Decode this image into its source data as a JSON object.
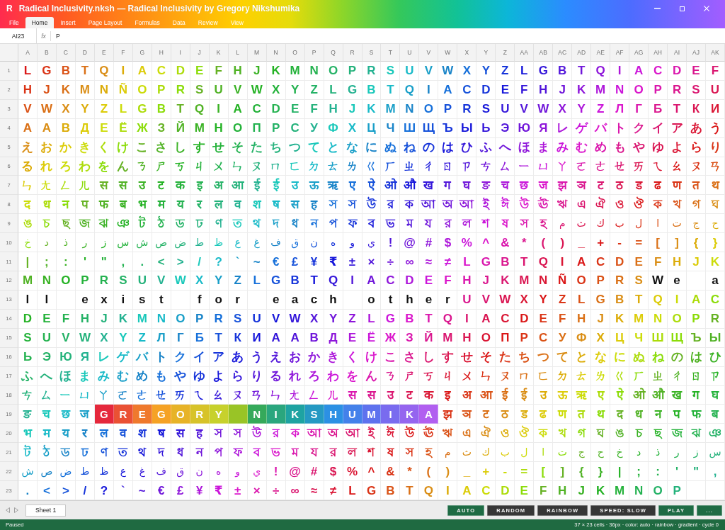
{
  "window": {
    "badge": "R",
    "title": "Radical Inclusivity.nksh — Radical Inclusivity by Gregory Nikshumika"
  },
  "menu": [
    {
      "label": "File",
      "selected": false
    },
    {
      "label": "Home",
      "selected": true
    },
    {
      "label": "Insert",
      "selected": false
    },
    {
      "label": "Page Layout",
      "selected": false
    },
    {
      "label": "Formulas",
      "selected": false
    },
    {
      "label": "Data",
      "selected": false
    },
    {
      "label": "Review",
      "selected": false
    },
    {
      "label": "View",
      "selected": false
    }
  ],
  "formula_bar": {
    "cell_ref": "AI23",
    "function_label": "fx",
    "value": "P"
  },
  "columns": [
    "A",
    "B",
    "C",
    "D",
    "E",
    "F",
    "G",
    "H",
    "I",
    "J",
    "K",
    "L",
    "M",
    "N",
    "O",
    "P",
    "Q",
    "R",
    "S",
    "T",
    "U",
    "V",
    "W",
    "X",
    "Y",
    "Z",
    "AA",
    "AB",
    "AC",
    "AD",
    "AE",
    "AF",
    "AG",
    "AH",
    "AI",
    "AJ",
    "AK"
  ],
  "rows": [
    {
      "number": "1",
      "segments": [
        {
          "kind": "glyphs",
          "chars": [
            "L",
            "G",
            "B",
            "T",
            "Q",
            "I",
            "A",
            "C",
            "D",
            "E",
            "F",
            "H",
            "J",
            "K",
            "M",
            "N",
            "O",
            "P",
            "R",
            "S",
            "U",
            "V",
            "W",
            "X",
            "Y",
            "Z",
            "L",
            "G",
            "B",
            "T",
            "Q",
            "I",
            "A",
            "C",
            "D",
            "E",
            "F"
          ]
        }
      ]
    },
    {
      "number": "2",
      "segments": [
        {
          "kind": "glyphs",
          "chars": [
            "H",
            "J",
            "K",
            "M",
            "N",
            "Ñ",
            "O",
            "P",
            "R",
            "S",
            "U",
            "V",
            "W",
            "X",
            "Y",
            "Z",
            "L",
            "G",
            "B",
            "T",
            "Q",
            "I",
            "A",
            "C",
            "D",
            "E",
            "F",
            "H",
            "J",
            "K",
            "M",
            "N",
            "O",
            "P",
            "R",
            "S",
            "U"
          ]
        }
      ]
    },
    {
      "number": "3",
      "segments": [
        {
          "kind": "glyphs",
          "chars": [
            "V",
            "W",
            "X",
            "Y",
            "Z",
            "L",
            "G",
            "B",
            "T",
            "Q",
            "I",
            "A",
            "C",
            "D",
            "E",
            "F",
            "H",
            "J",
            "K",
            "M",
            "N",
            "O",
            "P",
            "R",
            "S",
            "U",
            "V",
            "W",
            "X",
            "Y",
            "Z",
            "Л",
            "Г",
            "Б",
            "Т",
            "К",
            "И"
          ]
        }
      ]
    },
    {
      "number": "4",
      "segments": [
        {
          "kind": "glyphs",
          "chars": [
            "А",
            "А",
            "В",
            "Д",
            "Е",
            "Ё",
            "Ж",
            "З",
            "Й",
            "М",
            "Н",
            "О",
            "П",
            "Р",
            "С",
            "У",
            "Ф",
            "Х",
            "Ц",
            "Ч",
            "Ш",
            "Щ",
            "Ъ",
            "Ы",
            "Ь",
            "Э",
            "Ю",
            "Я",
            "レ",
            "ゲ",
            "バ",
            "ト",
            "ク",
            "イ",
            "ア",
            "あ",
            "う"
          ]
        }
      ]
    },
    {
      "number": "5",
      "segments": [
        {
          "kind": "glyphs",
          "chars": [
            "え",
            "お",
            "か",
            "き",
            "く",
            "け",
            "こ",
            "さ",
            "し",
            "す",
            "せ",
            "そ",
            "た",
            "ち",
            "つ",
            "て",
            "と",
            "な",
            "に",
            "ぬ",
            "ね",
            "の",
            "は",
            "ひ",
            "ふ",
            "へ",
            "ほ",
            "ま",
            "み",
            "む",
            "め",
            "も",
            "や",
            "ゆ",
            "よ",
            "ら",
            "り"
          ]
        }
      ]
    },
    {
      "number": "6",
      "segments": [
        {
          "kind": "glyphs",
          "chars": [
            "る",
            "れ",
            "ろ",
            "わ",
            "を",
            "ん",
            "ㄋ",
            "ㄕ",
            "ㄎ",
            "ㄐ",
            "ㄨ",
            "ㄣ",
            "ㄡ",
            "ㄇ",
            "ㄈ",
            "ㄉ",
            "ㄊ",
            "ㄌ",
            "ㄍ",
            "ㄏ",
            "ㄓ",
            "ㄔ",
            "ㄖ",
            "ㄗ",
            "ㄘ",
            "ㄙ",
            "ㄧ",
            "ㄩ",
            "ㄚ",
            "ㄛ",
            "ㄜ",
            "ㄝ",
            "ㄞ",
            "ㄟ",
            "ㄠ",
            "ㄡ",
            "ㄢ"
          ]
        }
      ]
    },
    {
      "number": "7",
      "segments": [
        {
          "kind": "glyphs",
          "chars": [
            "ㄣ",
            "ㄤ",
            "ㄥ",
            "ㄦ",
            "स",
            "स",
            "उ",
            "ट",
            "क",
            "इ",
            "अ",
            "आ",
            "ई",
            "ई",
            "उ",
            "ऊ",
            "ऋ",
            "ए",
            "ऐ",
            "ओ",
            "औ",
            "ख",
            "ग",
            "घ",
            "ङ",
            "च",
            "छ",
            "ज",
            "झ",
            "ञ",
            "ट",
            "ठ",
            "ड",
            "ढ",
            "ण",
            "त",
            "थ"
          ]
        }
      ]
    },
    {
      "number": "8",
      "segments": [
        {
          "kind": "glyphs",
          "chars": [
            "द",
            "ध",
            "न",
            "प",
            "फ",
            "ब",
            "भ",
            "म",
            "य",
            "र",
            "ल",
            "व",
            "श",
            "ष",
            "स",
            "ह",
            "স",
            "স",
            "উ",
            "র",
            "ক",
            "আ",
            "অ",
            "আ",
            "ই",
            "ঈ",
            "উ",
            "ঊ",
            "ঋ",
            "এ",
            "ঐ",
            "ও",
            "ঔ",
            "ক",
            "খ",
            "গ",
            "ঘ"
          ]
        }
      ]
    },
    {
      "number": "9",
      "segments": [
        {
          "kind": "glyphs",
          "chars": [
            "ঙ",
            "চ",
            "ছ",
            "জ",
            "ঝ",
            "ঞ",
            "ট",
            "ঠ",
            "ড",
            "ঢ",
            "ণ",
            "ত",
            "থ",
            "দ",
            "ধ",
            "ন",
            "প",
            "ফ",
            "ব",
            "ভ",
            "ম",
            "য",
            "র",
            "ল",
            "শ",
            "ষ",
            "স",
            "হ"
          ]
        },
        {
          "kind": "glyphs_rtl",
          "chars": [
            "ح",
            "ج",
            "ت",
            "ا",
            "ل",
            "ب",
            "ك",
            "ث",
            "م"
          ]
        }
      ]
    },
    {
      "number": "10",
      "segments": [
        {
          "kind": "glyphs_rtl",
          "chars": [
            "ي",
            "و",
            "ه",
            "ن",
            "ق",
            "ف",
            "غ",
            "ع",
            "ظ",
            "ط",
            "ض",
            "ص",
            "ش",
            "س",
            "ز",
            "ر",
            "ذ",
            "د",
            "خ"
          ]
        },
        {
          "kind": "glyphs",
          "chars": [
            "!",
            "@",
            "#",
            "$",
            "%",
            "^",
            "&",
            "*",
            "(",
            ")",
            "_",
            "+",
            "-",
            "=",
            "[",
            "]",
            "{",
            "}"
          ]
        }
      ]
    },
    {
      "number": "11",
      "segments": [
        {
          "kind": "glyphs",
          "chars": [
            "|",
            ";",
            ":",
            "'",
            "\"",
            ",",
            ".",
            "<",
            ">",
            "/",
            "?",
            "`",
            "~",
            "€",
            "£",
            "¥",
            "₹",
            "±",
            "×",
            "÷",
            "∞",
            "≈",
            "≠",
            "L",
            "G",
            "B",
            "T",
            "Q",
            "I",
            "A",
            "C",
            "D",
            "E",
            "F",
            "H",
            "J",
            "K"
          ]
        }
      ]
    },
    {
      "number": "12",
      "segments": [
        {
          "kind": "glyphs",
          "chars": [
            "M",
            "N",
            "O",
            "P",
            "R",
            "S",
            "U",
            "V",
            "W",
            "X",
            "Y",
            "Z",
            "L",
            "G",
            "B",
            "T",
            "Q",
            "I",
            "A",
            "C",
            "D",
            "E",
            "F",
            "H",
            "J",
            "K",
            "M",
            "N",
            "Ñ",
            "O",
            "P",
            "R",
            "S"
          ]
        },
        {
          "kind": "message",
          "chars": [
            "W",
            "e"
          ]
        },
        {
          "kind": "blank"
        },
        {
          "kind": "message",
          "chars": [
            "a"
          ]
        }
      ]
    },
    {
      "number": "13",
      "segments": [
        {
          "kind": "message",
          "chars": [
            "l",
            "l"
          ]
        },
        {
          "kind": "blank"
        },
        {
          "kind": "message",
          "chars": [
            "e",
            "x",
            "i",
            "s",
            "t"
          ]
        },
        {
          "kind": "blank"
        },
        {
          "kind": "message",
          "chars": [
            "f",
            "o",
            "r"
          ]
        },
        {
          "kind": "blank"
        },
        {
          "kind": "message",
          "chars": [
            "e",
            "a",
            "c",
            "h"
          ]
        },
        {
          "kind": "blank"
        },
        {
          "kind": "message",
          "chars": [
            "o",
            "t",
            "h",
            "e",
            "r"
          ]
        },
        {
          "kind": "glyphs",
          "chars": [
            "U",
            "V",
            "W",
            "X",
            "Y",
            "Z",
            "L",
            "G",
            "B",
            "T",
            "Q",
            "I",
            "A",
            "C"
          ]
        }
      ]
    },
    {
      "number": "14",
      "segments": [
        {
          "kind": "glyphs",
          "chars": [
            "D",
            "E",
            "F",
            "H",
            "J",
            "K",
            "M",
            "N",
            "O",
            "P",
            "R",
            "S",
            "U",
            "V",
            "W",
            "X",
            "Y",
            "Z",
            "L",
            "G",
            "B",
            "T",
            "Q",
            "I",
            "A",
            "C",
            "D",
            "E",
            "F",
            "H",
            "J",
            "K",
            "M",
            "N",
            "O",
            "P",
            "R"
          ]
        }
      ]
    },
    {
      "number": "15",
      "segments": [
        {
          "kind": "glyphs",
          "chars": [
            "S",
            "U",
            "V",
            "W",
            "X",
            "Y",
            "Z",
            "Л",
            "Г",
            "Б",
            "Т",
            "К",
            "И",
            "А",
            "А",
            "В",
            "Д",
            "Е",
            "Ё",
            "Ж",
            "З",
            "Й",
            "М",
            "Н",
            "О",
            "П",
            "Р",
            "С",
            "У",
            "Ф",
            "Х",
            "Ц",
            "Ч",
            "Ш",
            "Щ",
            "Ъ",
            "Ы"
          ]
        }
      ]
    },
    {
      "number": "16",
      "segments": [
        {
          "kind": "glyphs",
          "chars": [
            "Ь",
            "Э",
            "Ю",
            "Я",
            "レ",
            "ゲ",
            "バ",
            "ト",
            "ク",
            "イ",
            "ア",
            "あ",
            "う",
            "え",
            "お",
            "か",
            "き",
            "く",
            "け",
            "こ",
            "さ",
            "し",
            "す",
            "せ",
            "そ",
            "た",
            "ち",
            "つ",
            "て",
            "と",
            "な",
            "に",
            "ぬ",
            "ね",
            "の",
            "は",
            "ひ"
          ]
        }
      ]
    },
    {
      "number": "17",
      "segments": [
        {
          "kind": "glyphs",
          "chars": [
            "ふ",
            "へ",
            "ほ",
            "ま",
            "み",
            "む",
            "め",
            "も",
            "や",
            "ゆ",
            "よ",
            "ら",
            "り",
            "る",
            "れ",
            "ろ",
            "わ",
            "を",
            "ん",
            "ㄋ",
            "ㄕ",
            "ㄎ",
            "ㄐ",
            "ㄨ",
            "ㄣ",
            "ㄡ",
            "ㄇ",
            "ㄈ",
            "ㄉ",
            "ㄊ",
            "ㄌ",
            "ㄍ",
            "ㄏ",
            "ㄓ",
            "ㄔ",
            "ㄖ",
            "ㄗ"
          ]
        }
      ]
    },
    {
      "number": "18",
      "segments": [
        {
          "kind": "glyphs",
          "chars": [
            "ㄘ",
            "ㄙ",
            "ㄧ",
            "ㄩ",
            "ㄚ",
            "ㄛ",
            "ㄜ",
            "ㄝ",
            "ㄞ",
            "ㄟ",
            "ㄠ",
            "ㄡ",
            "ㄢ",
            "ㄣ",
            "ㄤ",
            "ㄥ",
            "ㄦ",
            "स",
            "स",
            "उ",
            "ट",
            "क",
            "इ",
            "अ",
            "आ",
            "ई",
            "ई",
            "उ",
            "ऊ",
            "ऋ",
            "ए",
            "ऐ",
            "ओ",
            "औ",
            "ख",
            "ग",
            "घ"
          ]
        }
      ]
    },
    {
      "number": "19",
      "segments": [
        {
          "kind": "glyphs",
          "chars": [
            "ङ",
            "च",
            "छ",
            "ज"
          ]
        },
        {
          "kind": "banner",
          "chars": [
            "G",
            "R",
            "E",
            "G",
            "O",
            "R",
            "Y"
          ]
        },
        {
          "kind": "banner_gap"
        },
        {
          "kind": "banner",
          "chars": [
            "N",
            "I",
            "K",
            "S",
            "H",
            "U",
            "M",
            "I",
            "K",
            "A"
          ]
        },
        {
          "kind": "glyphs",
          "chars": [
            "झ",
            "ञ",
            "ट",
            "ठ",
            "ड",
            "ढ",
            "ण",
            "त",
            "थ",
            "द",
            "ध",
            "न",
            "प",
            "फ",
            "ब"
          ]
        }
      ]
    },
    {
      "number": "20",
      "segments": [
        {
          "kind": "glyphs",
          "chars": [
            "भ",
            "म",
            "य",
            "र",
            "ल",
            "व",
            "श",
            "ष",
            "स",
            "ह",
            "স",
            "স",
            "উ",
            "র",
            "ক",
            "আ",
            "অ",
            "আ",
            "ই",
            "ঈ",
            "উ",
            "ঊ",
            "ঋ",
            "এ",
            "ঐ",
            "ও",
            "ঔ",
            "ক",
            "খ",
            "গ",
            "ঘ",
            "ঙ",
            "চ",
            "ছ",
            "জ",
            "ঝ",
            "ঞ"
          ]
        }
      ]
    },
    {
      "number": "21",
      "segments": [
        {
          "kind": "glyphs",
          "chars": [
            "ট",
            "ঠ",
            "ড",
            "ঢ",
            "ণ",
            "ত",
            "থ",
            "দ",
            "ধ",
            "ন",
            "প",
            "ফ",
            "ব",
            "ভ",
            "ম",
            "য",
            "র",
            "ল",
            "শ",
            "ষ",
            "স",
            "হ"
          ]
        },
        {
          "kind": "glyphs_rtl",
          "chars": [
            "س",
            "ز",
            "ر",
            "ذ",
            "د",
            "خ",
            "ح",
            "ج",
            "ت",
            "ا",
            "ل",
            "ب",
            "ك",
            "ث",
            "م"
          ]
        }
      ]
    },
    {
      "number": "22",
      "segments": [
        {
          "kind": "glyphs_rtl",
          "chars": [
            "ي",
            "و",
            "ه",
            "ن",
            "ق",
            "ف",
            "غ",
            "ع",
            "ظ",
            "ط",
            "ض",
            "ص",
            "ش"
          ]
        },
        {
          "kind": "glyphs",
          "chars": [
            "!",
            "@",
            "#",
            "$",
            "%",
            "^",
            "&",
            "*",
            "(",
            ")",
            "_",
            "+",
            "-",
            "=",
            "[",
            "]",
            "{",
            "}",
            "|",
            ";",
            ":",
            "'",
            "\"",
            ","
          ]
        }
      ]
    },
    {
      "number": "23",
      "segments": [
        {
          "kind": "glyphs",
          "chars": [
            ".",
            "<",
            ">",
            "/",
            "?",
            "`",
            "~",
            "€",
            "£",
            "¥",
            "₹",
            "±",
            "×",
            "÷",
            "∞",
            "≈",
            "≠",
            "L",
            "G",
            "B",
            "T",
            "Q",
            "I",
            "A",
            "C",
            "D",
            "E",
            "F",
            "H",
            "J",
            "K",
            "M",
            "N",
            "O",
            "P"
          ]
        },
        {
          "kind": "blank"
        },
        {
          "kind": "blank"
        }
      ]
    }
  ],
  "sheet_tabs": [
    {
      "label": "Sheet 1",
      "selected": true
    }
  ],
  "controls": [
    {
      "label": "AUTO",
      "kind": "toggle",
      "on": true
    },
    {
      "label": "RANDOM",
      "kind": "toggle",
      "on": false
    },
    {
      "label": "RAINBOW",
      "kind": "toggle",
      "on": false
    },
    {
      "label": "SPEED: SLOW",
      "kind": "toggle",
      "on": false
    },
    {
      "label": "PLAY",
      "kind": "action"
    },
    {
      "label": "...",
      "kind": "action"
    }
  ],
  "status_bar": {
    "state": "Paused",
    "info": "37 × 23 cells · 36px · color: auto · rainbow · gradient · cycle 0"
  }
}
